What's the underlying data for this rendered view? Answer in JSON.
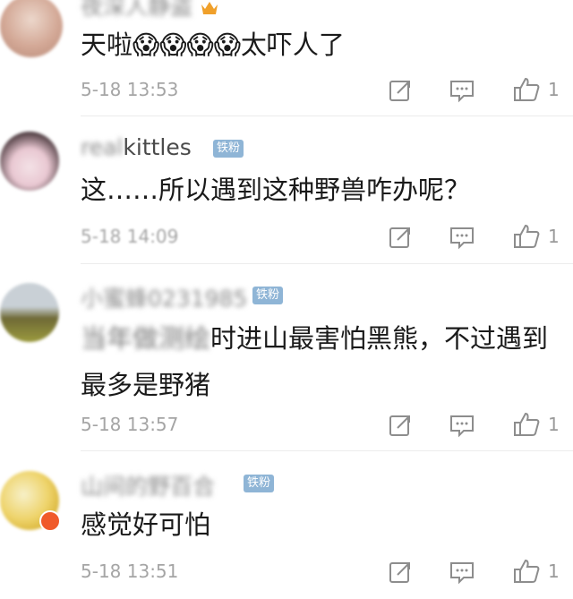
{
  "comments": [
    {
      "username_visible": "",
      "username_masked": "夜深人静盗",
      "has_vip_icon": true,
      "badge": "",
      "text_masked": "",
      "text": "天啦😱😱😱😱太吓人了",
      "time": "5-18 13:53",
      "likes": "1",
      "avatar_colors": [
        "#e8d2c6",
        "#c79a86"
      ]
    },
    {
      "username_visible": "kittles",
      "username_masked": "real",
      "has_vip_icon": false,
      "badge": "铁粉",
      "text_masked": "",
      "text": "这……所以遇到这种野兽咋办呢？",
      "time": "5-18 14:09",
      "likes": "1",
      "avatar_colors": [
        "#f1dbe3",
        "#3a2a2e"
      ]
    },
    {
      "username_visible": "",
      "username_masked": "小蜜蜂0231985",
      "has_vip_icon": false,
      "badge": "铁粉",
      "text_masked": "当年做测绘",
      "text": "时进山最害怕黑熊，不过遇到最多是野猪",
      "time": "5-18 13:57",
      "likes": "1",
      "avatar_colors": [
        "#c9d0d6",
        "#6d6a2e"
      ]
    },
    {
      "username_visible": "",
      "username_masked": "山间的野百合",
      "has_vip_icon": false,
      "badge": "铁粉",
      "text_masked": "",
      "text": "感觉好可怕",
      "time": "5-18 13:51",
      "likes": "1",
      "avatar_colors": [
        "#f4e9a8",
        "#d7b31e"
      ]
    }
  ]
}
